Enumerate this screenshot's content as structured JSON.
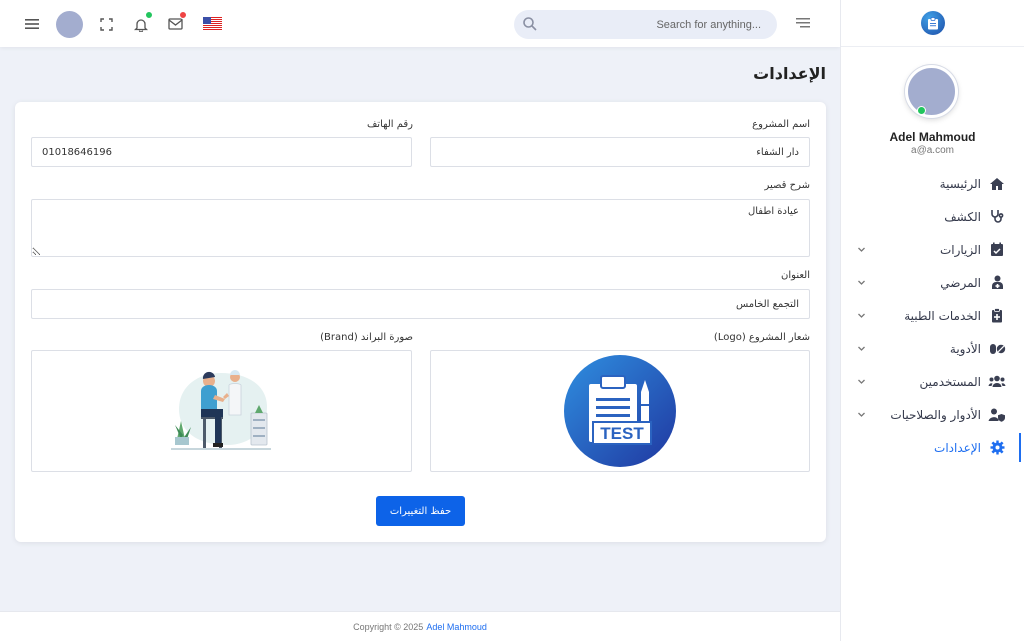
{
  "topbar": {
    "search_placeholder": "...Search for anything",
    "notifications_dot_color": "#22c55e",
    "mail_dot_color": "#ef4444"
  },
  "sidebar": {
    "user_name": "Adel Mahmoud",
    "user_email": "a@a.com",
    "items": [
      {
        "label": "الرئيسية",
        "icon": "home-icon",
        "has_submenu": false,
        "active": false
      },
      {
        "label": "الكشف",
        "icon": "stethoscope-icon",
        "has_submenu": false,
        "active": false
      },
      {
        "label": "الزيارات",
        "icon": "calendar-check-icon",
        "has_submenu": true,
        "active": false
      },
      {
        "label": "المرضي",
        "icon": "patient-icon",
        "has_submenu": true,
        "active": false
      },
      {
        "label": "الخدمات الطبية",
        "icon": "clipboard-icon",
        "has_submenu": true,
        "active": false
      },
      {
        "label": "الأدوية",
        "icon": "pills-icon",
        "has_submenu": true,
        "active": false
      },
      {
        "label": "المستخدمين",
        "icon": "users-icon",
        "has_submenu": true,
        "active": false
      },
      {
        "label": "الأدوار والصلاحيات",
        "icon": "user-shield-icon",
        "has_submenu": true,
        "active": false
      },
      {
        "label": "الإعدادات",
        "icon": "gear-icon",
        "has_submenu": false,
        "active": true
      }
    ],
    "accent_color": "#1e6ef0"
  },
  "page": {
    "title": "الإعدادات"
  },
  "form": {
    "project_name_label": "اسم المشروع",
    "project_name_value": "دار الشفاء",
    "phone_label": "رقم الهاتف",
    "phone_value": "01018646196",
    "description_label": "شرح قصير",
    "description_value": "عيادة اطفال",
    "address_label": "العنوان",
    "address_value": "التجمع الخامس",
    "logo_label": "شعار المشروع (Logo)",
    "logo_text": "TEST",
    "brand_label": "صورة البراند (Brand)",
    "save_label": "حفظ التغييرات"
  },
  "footer": {
    "copyright": "Copyright © 2025",
    "author": "Adel Mahmoud"
  }
}
